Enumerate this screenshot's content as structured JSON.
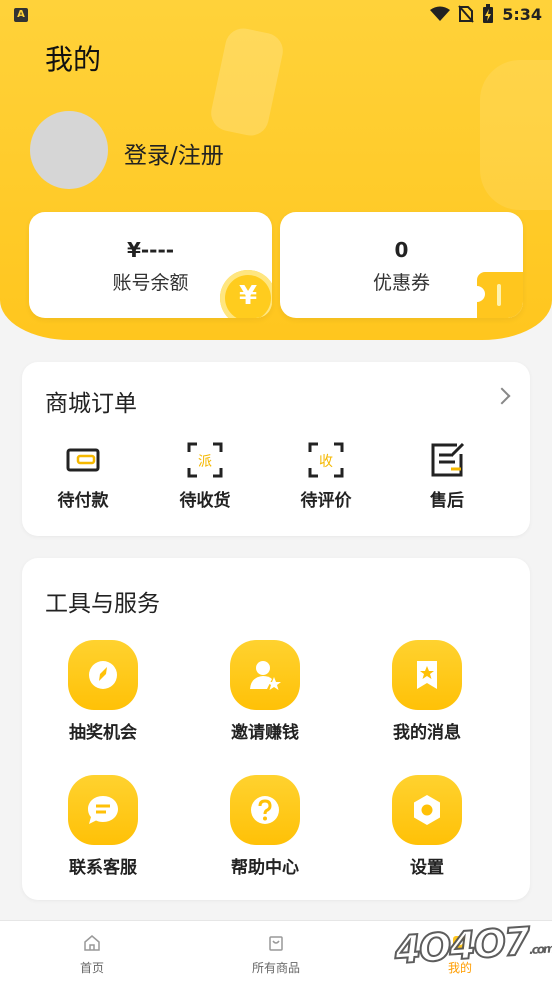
{
  "status_bar": {
    "app_badge": "A",
    "time": "5:34",
    "icons": [
      "wifi-icon",
      "no-sim-icon",
      "battery-charging-icon"
    ]
  },
  "header": {
    "title": "我的",
    "login_text": "登录/注册"
  },
  "account": {
    "balance_value": "¥----",
    "balance_label": "账号余额",
    "coupon_value": "0",
    "coupon_label": "优惠券",
    "yen_symbol": "¥"
  },
  "orders": {
    "title": "商城订单",
    "items": [
      {
        "label": "待付款",
        "icon": "wallet-icon"
      },
      {
        "label": "待收货",
        "icon": "dispatch-scan-icon",
        "glyph": "派"
      },
      {
        "label": "待评价",
        "icon": "receive-scan-icon",
        "glyph": "收"
      },
      {
        "label": "售后",
        "icon": "edit-note-icon"
      }
    ]
  },
  "tools": {
    "title": "工具与服务",
    "items": [
      {
        "label": "抽奖机会",
        "icon": "compass-icon"
      },
      {
        "label": "邀请赚钱",
        "icon": "user-star-icon"
      },
      {
        "label": "我的消息",
        "icon": "bookmark-star-icon"
      },
      {
        "label": "联系客服",
        "icon": "chat-bubble-icon"
      },
      {
        "label": "帮助中心",
        "icon": "question-icon"
      },
      {
        "label": "设置",
        "icon": "hexagon-settings-icon"
      }
    ]
  },
  "tabbar": {
    "items": [
      {
        "label": "首页",
        "icon": "home-icon"
      },
      {
        "label": "所有商品",
        "icon": "shopping-bag-icon"
      },
      {
        "label": "我的",
        "icon": "profile-icon",
        "active": true
      }
    ]
  },
  "watermark": {
    "text": "4O4O7",
    "suffix": ".com"
  },
  "colors": {
    "brand_yellow": "#ffc61e",
    "active_tab": "#ff9d00",
    "background": "#f4f4f4"
  }
}
